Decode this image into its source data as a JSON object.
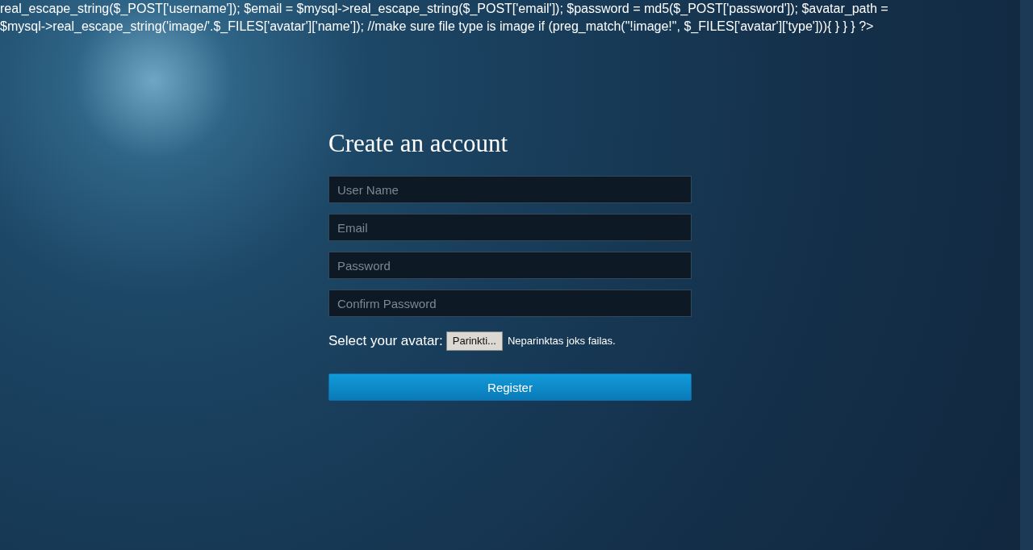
{
  "code_text": "real_escape_string($_POST['username']); $email = $mysql->real_escape_string($_POST['email']); $password = md5($_POST['password']); $avatar_path = $mysql->real_escape_string('image/'.$_FILES['avatar']['name']); //make sure file type is image if (preg_match(\"!image!\", $_FILES['avatar']['type'])){ } } } ?>",
  "form": {
    "title": "Create an account",
    "fields": [
      {
        "placeholder": "User Name"
      },
      {
        "placeholder": "Email"
      },
      {
        "placeholder": "Password"
      },
      {
        "placeholder": "Confirm Password"
      }
    ],
    "avatar": {
      "label": "Select your avatar:",
      "button": "Parinkti...",
      "status": "Neparinktas joks failas."
    },
    "submit": "Register"
  }
}
